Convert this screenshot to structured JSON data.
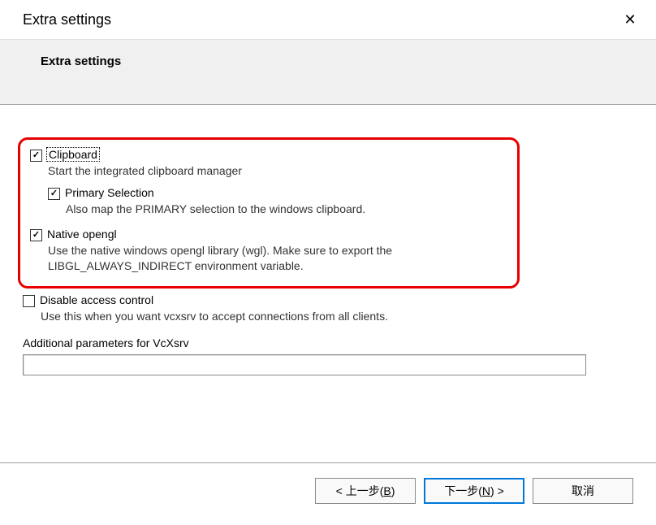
{
  "window": {
    "title": "Extra settings",
    "close_glyph": "✕"
  },
  "header": {
    "title": "Extra settings"
  },
  "options": {
    "clipboard": {
      "label": "Clipboard",
      "checked": true,
      "focused": true,
      "desc": "Start the integrated clipboard manager"
    },
    "primary_selection": {
      "label": "Primary Selection",
      "checked": true,
      "desc": "Also map the PRIMARY selection to the windows clipboard."
    },
    "native_opengl": {
      "label": "Native opengl",
      "checked": true,
      "desc": "Use the native windows opengl library (wgl). Make sure to export the LIBGL_ALWAYS_INDIRECT environment variable."
    },
    "disable_access": {
      "label": "Disable access control",
      "checked": false,
      "desc": "Use this when you want vcxsrv to accept connections from all clients."
    },
    "additional_params": {
      "label": "Additional parameters for VcXsrv",
      "value": ""
    }
  },
  "footer": {
    "back": {
      "prefix": "< 上一步(",
      "hotkey": "B",
      "suffix": ")"
    },
    "next": {
      "prefix": "下一步(",
      "hotkey": "N",
      "suffix": ") >"
    },
    "cancel": "取消"
  }
}
